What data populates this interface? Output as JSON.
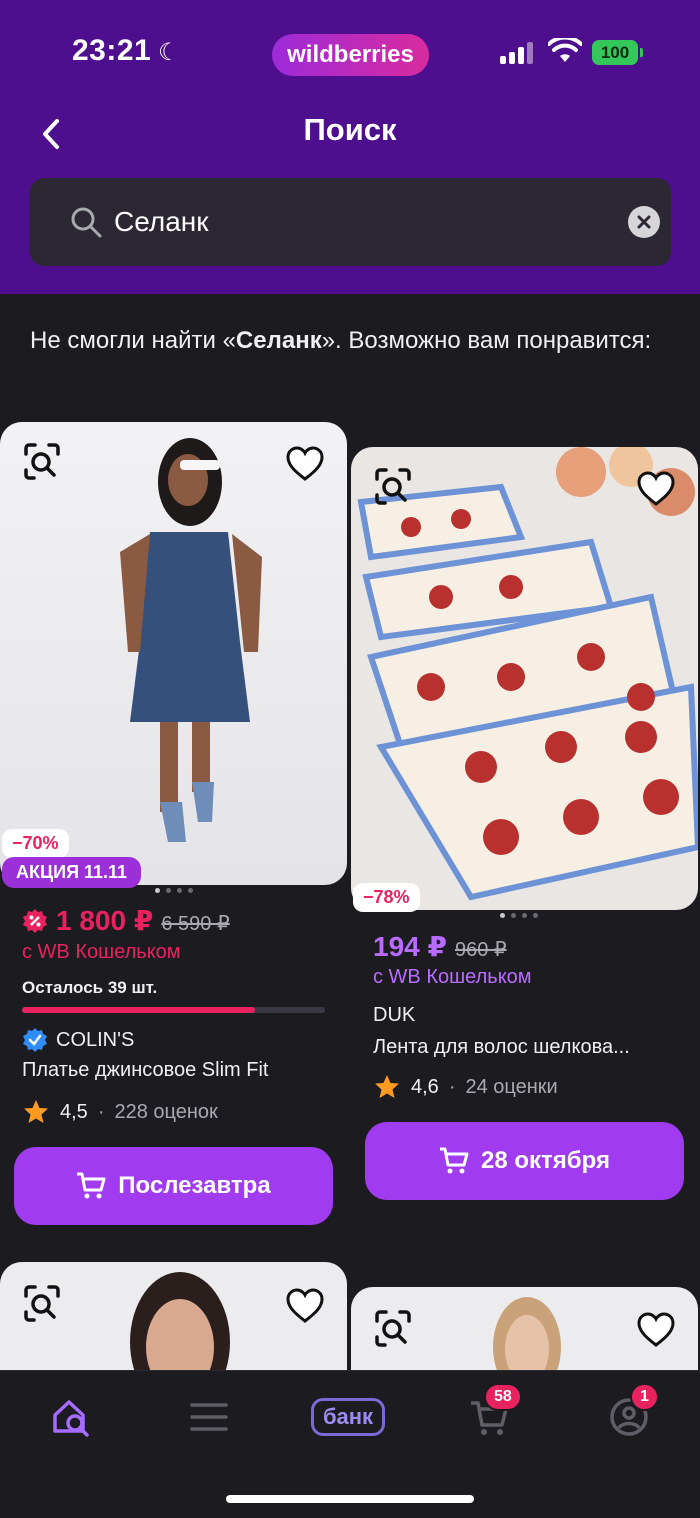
{
  "status_bar": {
    "time": "23:21",
    "brand": "wildberries",
    "battery": "100"
  },
  "header": {
    "title": "Поиск"
  },
  "search": {
    "value": "Селанк"
  },
  "message": {
    "prefix": "Не смогли найти «",
    "query": "Селанк",
    "suffix": "». Возможно вам понравится:"
  },
  "products": [
    {
      "discount": "−70%",
      "promo": "АКЦИЯ 11.11",
      "price": "1 800 ₽",
      "old_price": "6 590 ₽",
      "wallet": "с WB Кошельком",
      "stock_note": "Осталось 39 шт.",
      "stock_level": 0.77,
      "brand": "COLIN'S",
      "name": "Платье джинсовое Slim Fit",
      "rating": "4,5",
      "reviews": "228 оценок",
      "button": "Послезавтра",
      "price_color": "#e8225f"
    },
    {
      "discount": "−78%",
      "price": "194 ₽",
      "old_price": "960 ₽",
      "wallet": "с WB Кошельком",
      "brand": "DUK",
      "name": "Лента для волос шелкова...",
      "rating": "4,6",
      "reviews": "24 оценки",
      "button": "28 октября",
      "price_color": "#b86bff"
    }
  ],
  "tabbar": {
    "items": [
      "home-search",
      "catalog",
      "bank",
      "cart",
      "profile"
    ],
    "bank_label": "банк",
    "cart_count": "58",
    "profile_count": "1"
  },
  "colors": {
    "accent": "#a03bef",
    "header_bg": "#4e0f8f",
    "sale": "#e8225f"
  }
}
